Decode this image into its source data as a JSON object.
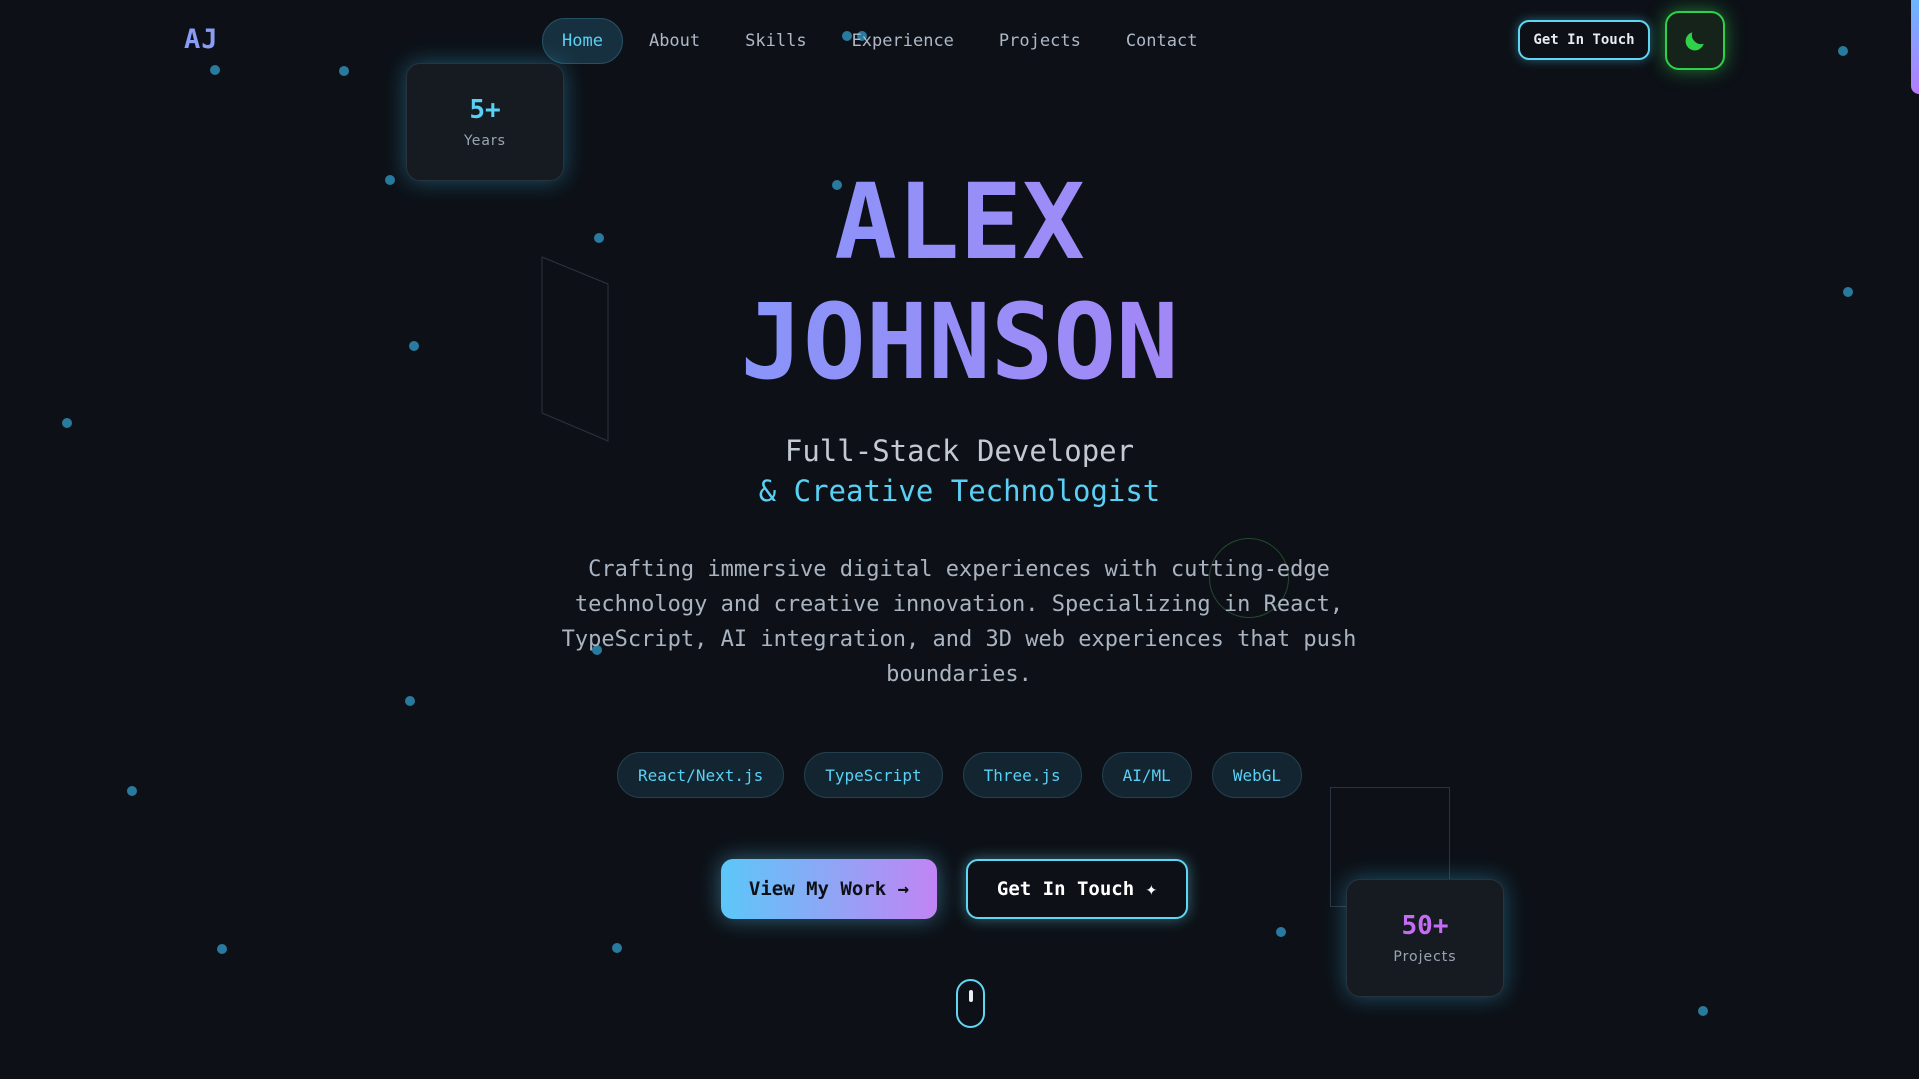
{
  "header": {
    "logo": "AJ",
    "nav": [
      "Home",
      "About",
      "Skills",
      "Experience",
      "Projects",
      "Contact"
    ],
    "active_nav": "Home",
    "cta_label": "Get In Touch",
    "theme_icon": "moon-icon"
  },
  "stats": [
    {
      "value": "5+",
      "label": "Years",
      "color": "#5ad0f5"
    },
    {
      "value": "50+",
      "label": "Projects",
      "color": "#c56cf4"
    }
  ],
  "hero": {
    "first_name": "ALEX",
    "last_name": "JOHNSON",
    "role_line1": "Full-Stack Developer",
    "role_line2": "& Creative Technologist",
    "bio": "Crafting immersive digital experiences with cutting-edge technology and creative innovation. Specializing in React, TypeScript, AI integration, and 3D web experiences that push boundaries.",
    "tags": [
      "React/Next.js",
      "TypeScript",
      "Three.js",
      "AI/ML",
      "WebGL"
    ],
    "primary_cta": "View My Work →",
    "secondary_cta": "Get In Touch ✦"
  },
  "colors": {
    "background": "#0d1117",
    "accent_cyan": "#5ad0f5",
    "accent_purple": "#c56cf4",
    "theme_green": "#2fd04a"
  }
}
